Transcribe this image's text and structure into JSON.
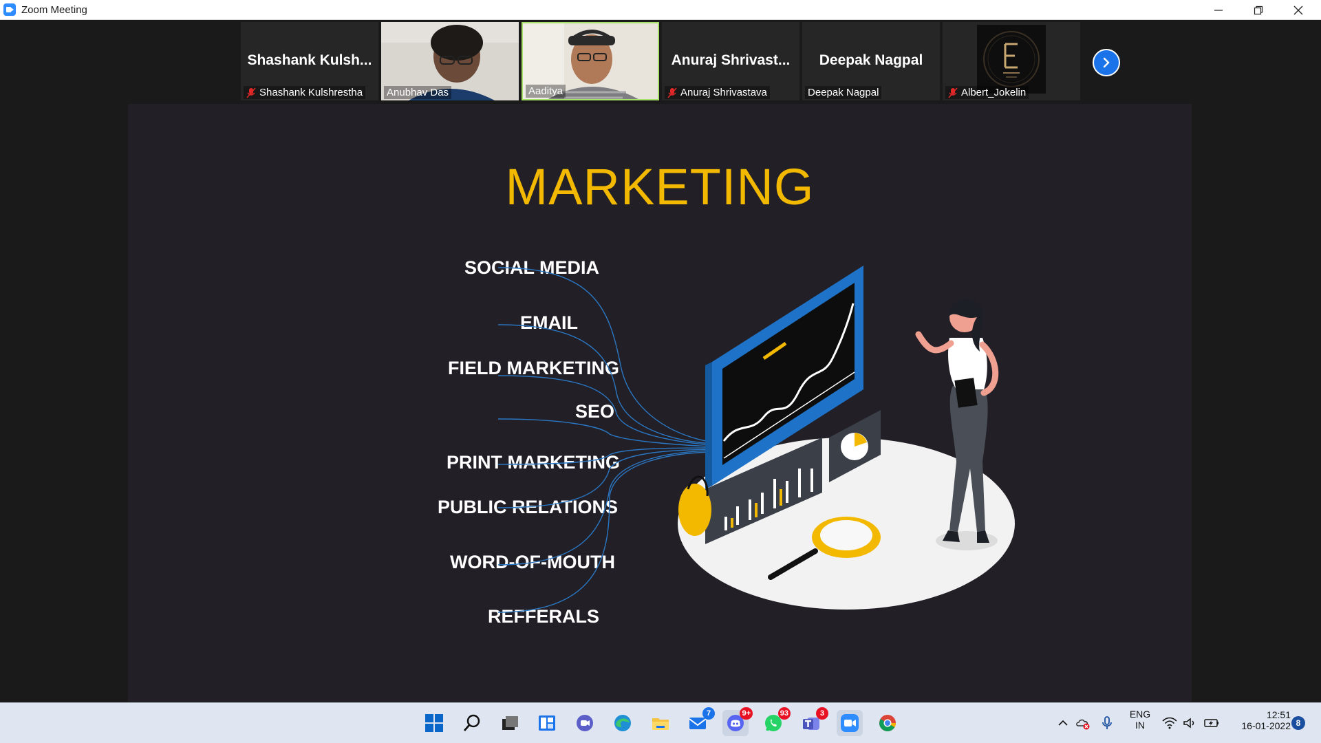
{
  "window": {
    "title": "Zoom Meeting",
    "controls": {
      "minimize": "—",
      "restore": "❐",
      "close": "✕"
    }
  },
  "gallery": {
    "participants": [
      {
        "big_name": "Shashank  Kulsh...",
        "label": "Shashank Kulshrestha",
        "muted": true,
        "video": false
      },
      {
        "big_name": "",
        "label": "Anubhav Das",
        "muted": false,
        "video": true
      },
      {
        "big_name": "",
        "label": "Aaditya",
        "muted": false,
        "video": true,
        "active_speaker": true
      },
      {
        "big_name": "Anuraj  Shrivast...",
        "label": "Anuraj Shrivastava",
        "muted": true,
        "video": false
      },
      {
        "big_name": "Deepak Nagpal",
        "label": "Deepak Nagpal",
        "muted": false,
        "video": false
      },
      {
        "big_name": "",
        "label": "Albert_Jokelin",
        "muted": true,
        "video": false,
        "avatar": "E-CELL logo"
      }
    ],
    "next_page_icon": "chevron-right-icon"
  },
  "slide": {
    "title": "MARKETING",
    "items": [
      "SOCIAL  MEDIA",
      "EMAIL",
      "FIELD MARKETING",
      "SEO",
      "PRINT MARKETING",
      "PUBLIC RELATIONS",
      "WORD-OF-MOUTH",
      "REFFERALS"
    ],
    "colors": {
      "background": "#221f27",
      "title": "#f3b900",
      "accent_blue": "#1e73c8",
      "lines": "#2a78c4"
    }
  },
  "taskbar": {
    "apps": [
      {
        "name": "start-icon"
      },
      {
        "name": "search-icon"
      },
      {
        "name": "task-view-icon"
      },
      {
        "name": "widgets-icon"
      },
      {
        "name": "chat-icon"
      },
      {
        "name": "edge-icon"
      },
      {
        "name": "file-explorer-icon"
      },
      {
        "name": "mail-icon",
        "badge": "7"
      },
      {
        "name": "discord-icon",
        "badge": "9+"
      },
      {
        "name": "whatsapp-icon",
        "badge": "93"
      },
      {
        "name": "teams-icon",
        "badge": "3"
      },
      {
        "name": "zoom-icon"
      },
      {
        "name": "chrome-icon"
      }
    ],
    "tray": {
      "language_top": "ENG",
      "language_bottom": "IN",
      "time": "12:51",
      "date": "16-01-2022",
      "notifications": "8"
    }
  }
}
